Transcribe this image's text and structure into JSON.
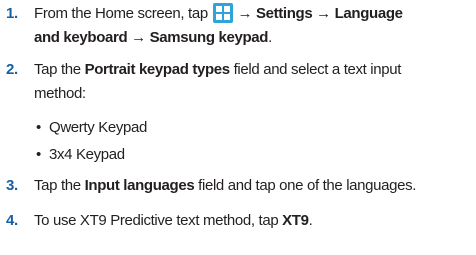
{
  "steps": [
    {
      "number": "1.",
      "line1_a": "From the Home screen, tap",
      "line1_icon": "apps-grid-icon",
      "line1_b": "→ Settings → Language",
      "line2_a": "and keyboard → Samsung keypad",
      "line2_b": "."
    },
    {
      "number": "2.",
      "line1_a": "Tap the ",
      "line1_bold": "Portrait keypad types",
      "line1_b": " field and select a text input",
      "line2": "method:",
      "bullets": [
        "Qwerty Keypad",
        "3x4 Keypad"
      ]
    },
    {
      "number": "3.",
      "text_a": "Tap the ",
      "text_bold": "Input languages",
      "text_b": " field and tap one of the languages."
    },
    {
      "number": "4.",
      "text_a": "To use XT9 Predictive text method, tap ",
      "text_bold": "XT9",
      "text_b": "."
    }
  ],
  "colors": {
    "step_number": "#1560a5",
    "body_text": "#231f20",
    "apps_icon": "#2fa4d8"
  }
}
